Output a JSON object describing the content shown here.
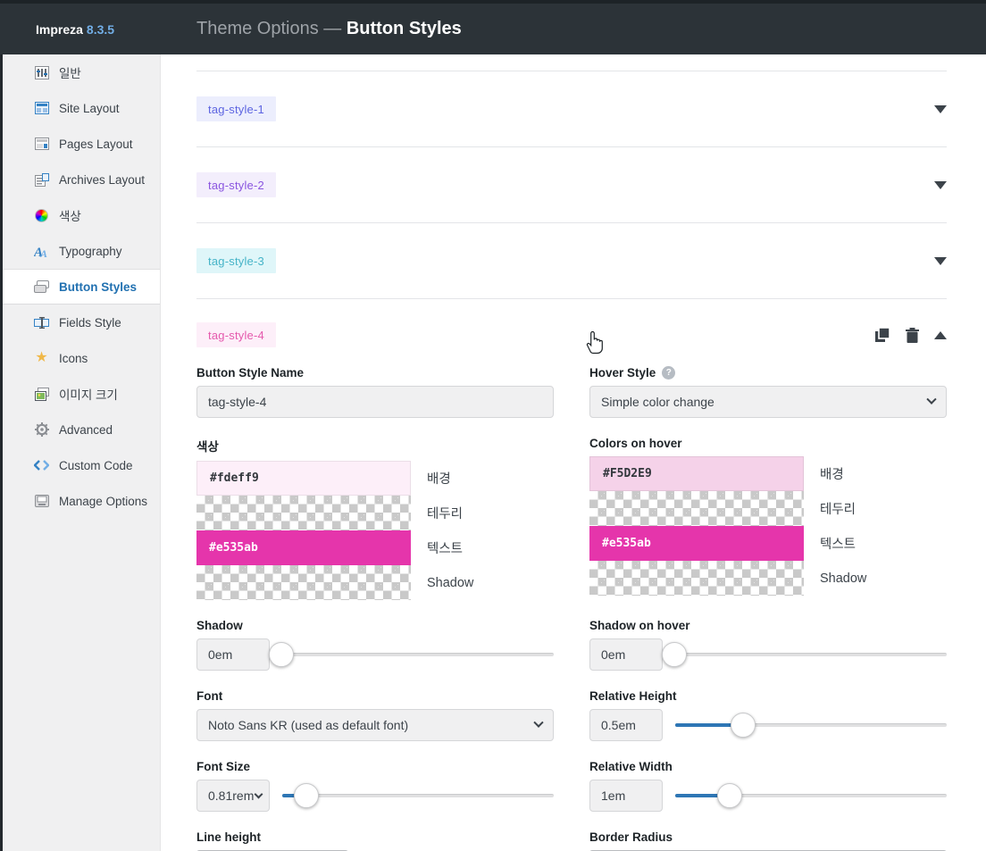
{
  "app": {
    "brand": "Impreza",
    "version": "8.3.5",
    "title_prefix": "Theme Options —",
    "title": "Button Styles",
    "header_bg": "#2c3338",
    "accent_blue": "#2271b1",
    "slider_blue": "#2e76b5"
  },
  "sidebar": {
    "items": [
      {
        "label": "일반",
        "icon": "sliders-icon"
      },
      {
        "label": "Site Layout",
        "icon": "site-layout-icon"
      },
      {
        "label": "Pages Layout",
        "icon": "pages-layout-icon"
      },
      {
        "label": "Archives Layout",
        "icon": "archives-layout-icon"
      },
      {
        "label": "색상",
        "icon": "color-wheel-icon"
      },
      {
        "label": "Typography",
        "icon": "typography-icon"
      },
      {
        "label": "Button Styles",
        "icon": "button-styles-icon",
        "active": true
      },
      {
        "label": "Fields Style",
        "icon": "fields-style-icon"
      },
      {
        "label": "Icons",
        "icon": "star-icon"
      },
      {
        "label": "이미지 크기",
        "icon": "image-sizes-icon"
      },
      {
        "label": "Advanced",
        "icon": "gear-icon"
      },
      {
        "label": "Custom Code",
        "icon": "code-icon"
      },
      {
        "label": "Manage Options",
        "icon": "drive-icon"
      }
    ]
  },
  "accordion": {
    "rows": [
      {
        "tag": "tag-style-1",
        "tag_style": "background:#eceefd;color:#5d65e1"
      },
      {
        "tag": "tag-style-2",
        "tag_style": "background:#f3eefc;color:#8a55e0"
      },
      {
        "tag": "tag-style-3",
        "tag_style": "background:#dff6f9;color:#46b4c8"
      }
    ],
    "expanded": {
      "tag": "tag-style-4",
      "tag_style": "background:#fdeff9;color:#e559ad"
    },
    "icons": {
      "duplicate": "duplicate-icon",
      "delete": "trash-icon",
      "collapse": "chevron-up-icon",
      "expand": "chevron-down-icon"
    }
  },
  "form": {
    "name": {
      "label": "Button Style Name",
      "value": "tag-style-4"
    },
    "hover": {
      "label": "Hover Style",
      "value": "Simple color change",
      "help_glyph": "?"
    },
    "colors": {
      "label": "색상",
      "rows": [
        {
          "value": "#fdeff9",
          "label": "배경",
          "style": "background:#fdeff9;color:#32373c"
        },
        {
          "value": "",
          "label": "테두리",
          "transparent": true
        },
        {
          "value": "#e535ab",
          "label": "텍스트",
          "style": "background:#e535ab;color:#ffffff"
        },
        {
          "value": "",
          "label": "Shadow",
          "transparent": true
        }
      ]
    },
    "colors_hover": {
      "label": "Colors on hover",
      "rows": [
        {
          "value": "#F5D2E9",
          "label": "배경",
          "style": "background:#f5d2e9;color:#32373c"
        },
        {
          "value": "",
          "label": "테두리",
          "transparent": true
        },
        {
          "value": "#e535ab",
          "label": "텍스트",
          "style": "background:#e535ab;color:#ffffff"
        },
        {
          "value": "",
          "label": "Shadow",
          "transparent": true
        }
      ]
    },
    "shadow": {
      "label": "Shadow",
      "value": "0em",
      "fill_style": "width:0%",
      "handle_style": "left:4%"
    },
    "shadow_hover": {
      "label": "Shadow on hover",
      "value": "0em",
      "fill_style": "width:0%",
      "handle_style": "left:4%"
    },
    "font": {
      "label": "Font",
      "value": "Noto Sans KR (used as default font)"
    },
    "relative_height": {
      "label": "Relative Height",
      "value": "0.5em",
      "fill_style": "width:25%",
      "handle_style": "left:25%"
    },
    "font_size": {
      "label": "Font Size",
      "value": "0.81rem",
      "fill_style": "width:6%",
      "handle_style": "left:9%"
    },
    "relative_width": {
      "label": "Relative Width",
      "value": "1em",
      "fill_style": "width:17%",
      "handle_style": "left:20%"
    },
    "line_height": {
      "label": "Line height"
    },
    "border_radius": {
      "label": "Border Radius"
    }
  }
}
